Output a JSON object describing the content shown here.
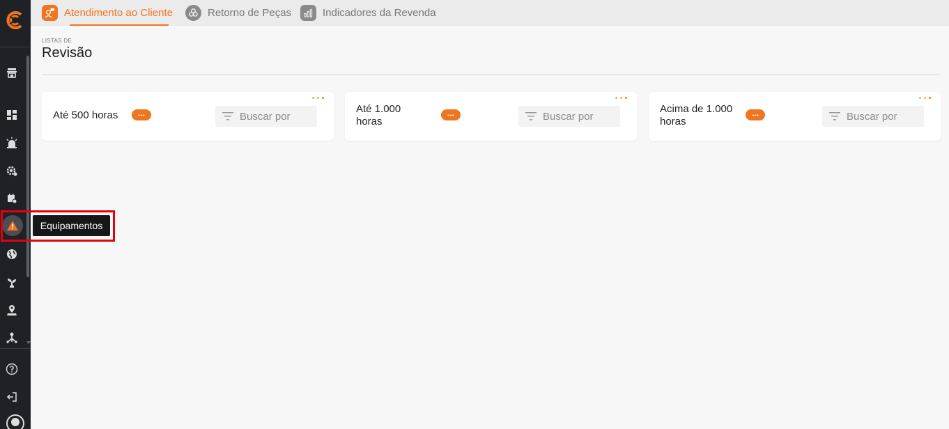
{
  "tabs": [
    {
      "label": "Atendimento ao Cliente",
      "icon": "customer-service-icon",
      "active": true
    },
    {
      "label": "Retorno de Peças",
      "icon": "parts-return-icon",
      "active": false
    },
    {
      "label": "Indicadores da Revenda",
      "icon": "dealer-indicators-icon",
      "active": false
    }
  ],
  "header": {
    "breadcrumb": "LISTAS DE",
    "title": "Revisão"
  },
  "cards": [
    {
      "title_line1": "Até 500 horas",
      "title_line2": "",
      "badge": "---",
      "search_placeholder": "Buscar por"
    },
    {
      "title_line1": "Até 1.000",
      "title_line2": "horas",
      "badge": "---",
      "search_placeholder": "Buscar por"
    },
    {
      "title_line1": "Acima de 1.000",
      "title_line2": "horas",
      "badge": "---",
      "search_placeholder": "Buscar por"
    }
  ],
  "sidebar": {
    "tooltip": "Equipamentos",
    "items": [
      "dealer-icon",
      "dashboard-icon",
      "alarm-icon",
      "settings-icon",
      "calendar-icon",
      "warning-icon",
      "globe-icon",
      "plant-icon",
      "location-icon",
      "org-chart-icon",
      "help-icon",
      "logout-icon",
      "user-icon"
    ]
  },
  "colors": {
    "accent": "#f07520",
    "sidebar": "#1e2227",
    "highlight": "#e3000f"
  }
}
